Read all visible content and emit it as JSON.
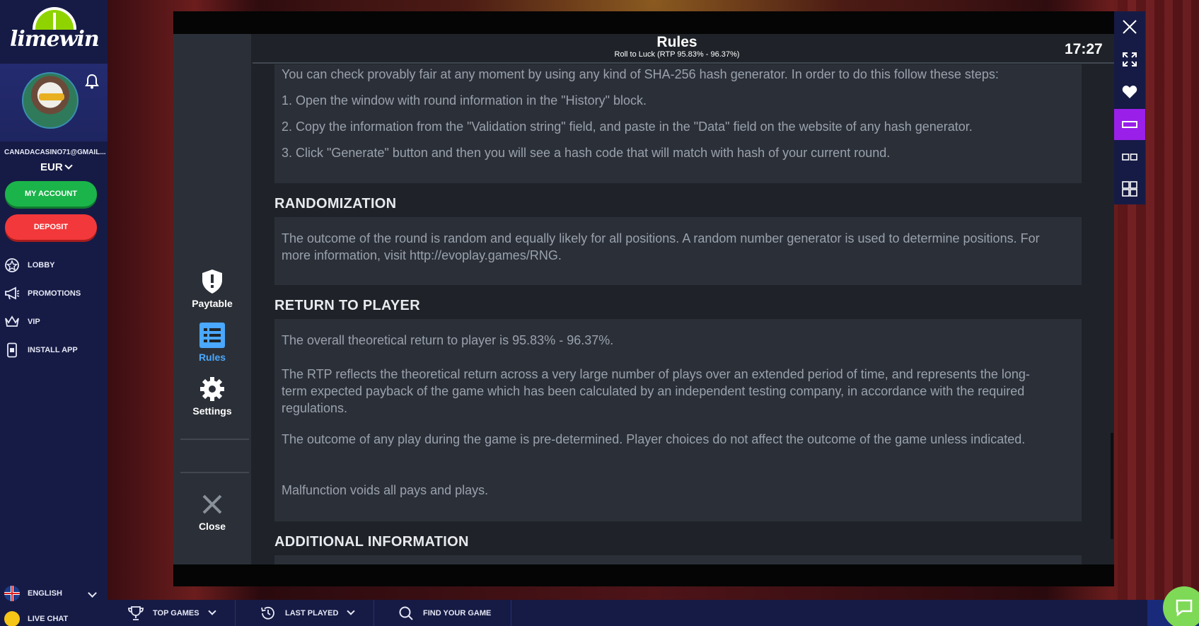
{
  "brand": {
    "logo_text": "limewin"
  },
  "user": {
    "email": "CANADACASINO71@GMAIL...",
    "currency": "EUR"
  },
  "buttons": {
    "my_account": "MY ACCOUNT",
    "deposit": "DEPOSIT"
  },
  "nav": [
    {
      "label": "LOBBY",
      "icon": "lobby-icon"
    },
    {
      "label": "PROMOTIONS",
      "icon": "megaphone-icon"
    },
    {
      "label": "VIP",
      "icon": "crown-icon"
    },
    {
      "label": "INSTALL APP",
      "icon": "phone-icon"
    }
  ],
  "language": "ENGLISH",
  "live_chat": "LIVE CHAT",
  "bottom_bar": {
    "top_games": "TOP GAMES",
    "last_played": "LAST PLAYED",
    "find_game": "FIND YOUR GAME"
  },
  "game_menu": {
    "paytable": "Paytable",
    "rules": "Rules",
    "settings": "Settings",
    "close": "Close"
  },
  "rules": {
    "title": "Rules",
    "subtitle": "Roll to Luck (RTP 95.83% - 96.37%)",
    "clock": "17:27",
    "provably_fair": {
      "intro": "You can check provably fair at any moment by using any kind of SHA-256 hash generator. In order to do this follow these steps:",
      "step1": "1. Open the window with round information in the \"History\" block.",
      "step2": "2. Copy the information from the \"Validation string\" field, and paste in the \"Data\" field on the website of any hash generator.",
      "step3": "3. Click \"Generate\" button and then you will see a hash code that will match with hash of your current round."
    },
    "randomization": {
      "heading": "RANDOMIZATION",
      "text": "The outcome of the round is random and equally likely for all positions. A random number generator is used to determine positions. For more information, visit http://evoplay.games/RNG."
    },
    "rtp": {
      "heading": "RETURN TO PLAYER",
      "p1": "The overall theoretical return to player is 95.83% - 96.37%.",
      "p2": "The RTP reflects the theoretical return across a very large number of plays over an extended period of time, and represents the long-term expected payback of the game which has been calculated by an independent testing company, in accordance with the required regulations.",
      "p3": "The outcome of any play during the game is pre-determined. Player choices do not affect the outcome of the game unless indicated.",
      "p4": "Malfunction voids all pays and plays."
    },
    "additional": {
      "heading": "ADDITIONAL INFORMATION"
    }
  },
  "colors": {
    "accent_active": "#9a1fe8",
    "account_green": "#1bb44a",
    "deposit_red": "#f2383a",
    "rules_active": "#4aa8ff"
  }
}
